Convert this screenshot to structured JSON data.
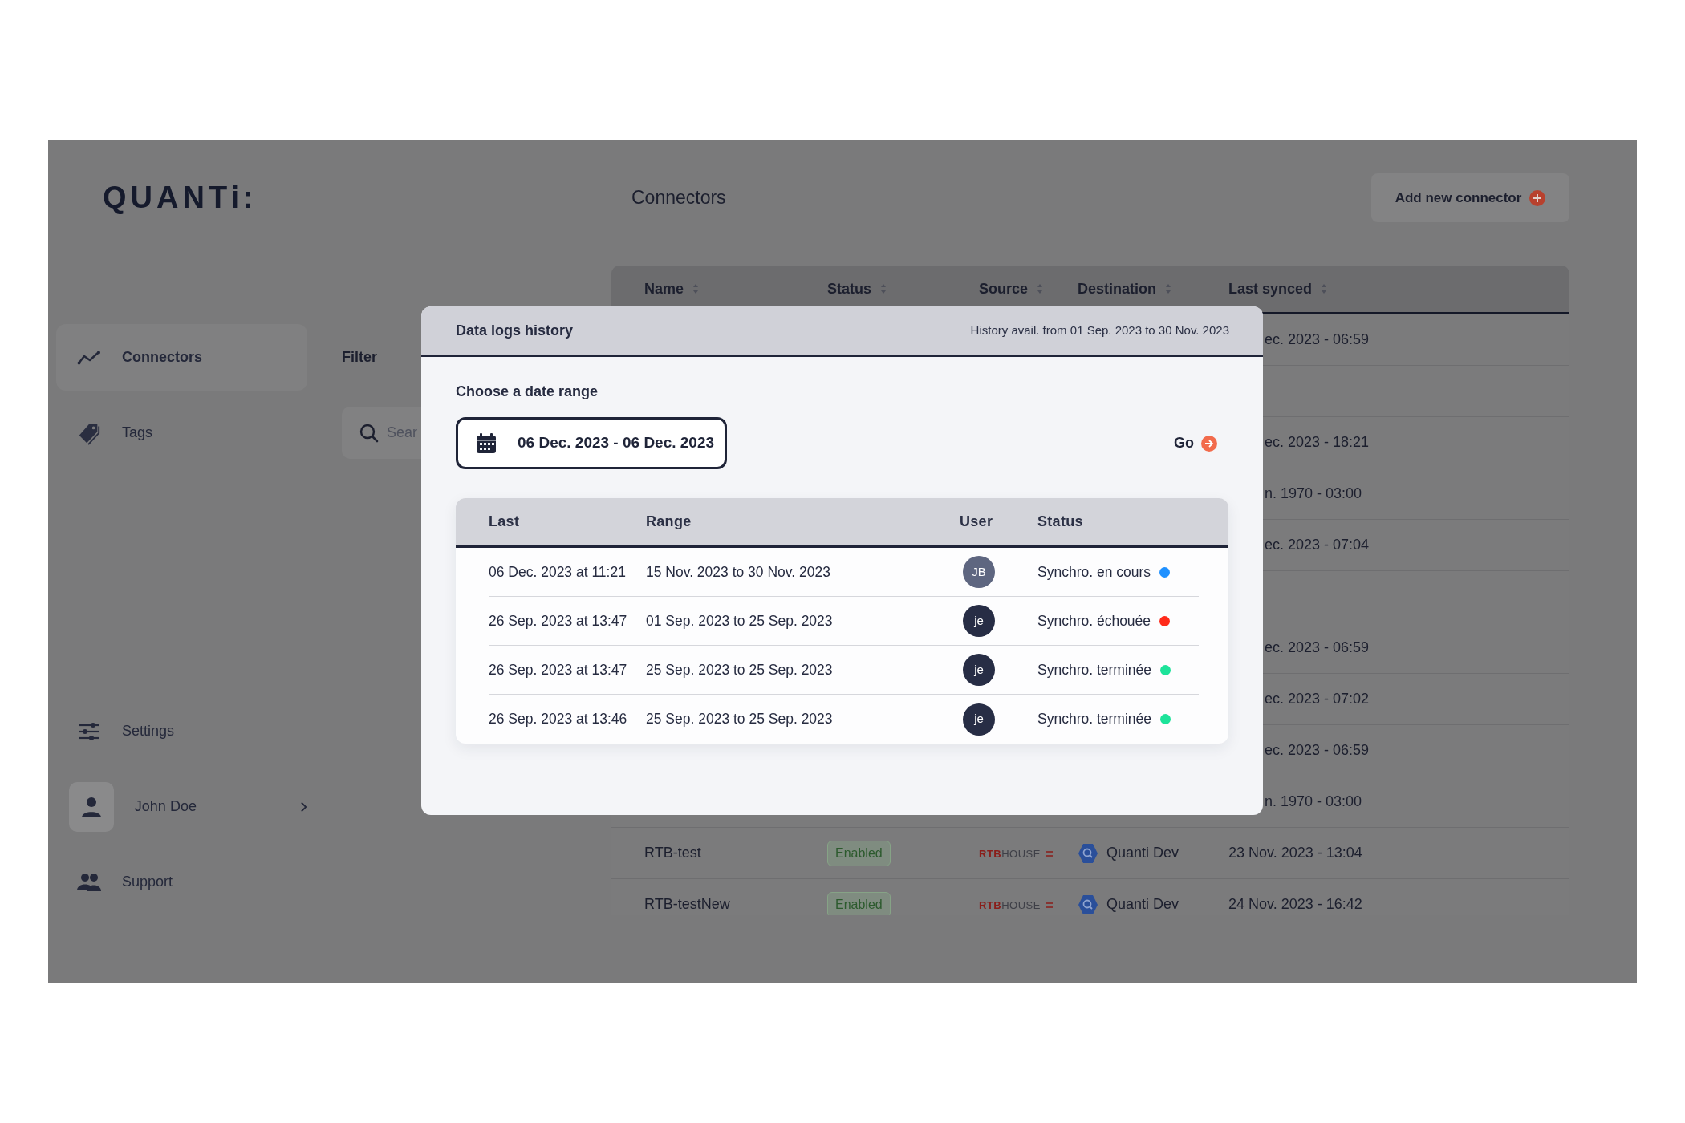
{
  "logo": "QUANTi:",
  "page_title": "Connectors",
  "add_button": "Add new connector",
  "sidebar": {
    "top_items": [
      {
        "label": "Connectors",
        "kind": "nav",
        "selected": true
      },
      {
        "label": "Tags",
        "kind": "nav",
        "selected": false
      }
    ],
    "bottom_items": [
      {
        "label": "Settings",
        "kind": "nav",
        "selected": false
      },
      {
        "label": "John Doe",
        "kind": "user",
        "selected": false
      },
      {
        "label": "Support",
        "kind": "nav",
        "selected": false
      }
    ]
  },
  "filter": {
    "label": "Filter",
    "search_placeholder": "Sear"
  },
  "table": {
    "columns": [
      "Name",
      "Status",
      "Source",
      "Destination",
      "Last synced"
    ],
    "rows": [
      {
        "last_synced": "ec. 2023 - 06:59"
      },
      {},
      {
        "last_synced": "ec. 2023 - 18:21"
      },
      {
        "last_synced": "n. 1970 - 03:00"
      },
      {
        "last_synced": "ec. 2023 - 07:04"
      },
      {},
      {
        "last_synced": "ec. 2023 - 06:59"
      },
      {
        "last_synced": "ec. 2023 - 07:02"
      },
      {
        "last_synced": "ec. 2023 - 06:59"
      },
      {
        "last_synced": "n. 1970 - 03:00"
      },
      {
        "name": "RTB-test",
        "status": "Enabled",
        "source": {
          "mark": "RTB",
          "name": "HOUSE"
        },
        "destination": "Quanti Dev",
        "last_synced": "23 Nov. 2023 - 13:04"
      },
      {
        "name": "RTB-testNew",
        "status": "Enabled",
        "source": {
          "mark": "RTB",
          "name": "HOUSE"
        },
        "destination": "Quanti Dev",
        "last_synced": "24 Nov. 2023 - 16:42"
      }
    ]
  },
  "modal": {
    "title": "Data logs history",
    "availability": "History avail. from 01 Sep. 2023 to 30 Nov. 2023",
    "range_label": "Choose a date range",
    "date_range": "06 Dec. 2023 - 06 Dec. 2023",
    "go_label": "Go",
    "columns": [
      "Last",
      "Range",
      "User",
      "Status"
    ],
    "rows": [
      {
        "last": "06 Dec. 2023 at 11:21",
        "range": "15 Nov. 2023 to 30 Nov. 2023",
        "user": {
          "initials": "JB",
          "color": "#5e6680"
        },
        "status": "Synchro. en cours",
        "color": "#1e90ff"
      },
      {
        "last": "26 Sep. 2023 at 13:47",
        "range": "01 Sep. 2023 to 25 Sep. 2023",
        "user": {
          "initials": "je",
          "color": "#272d45"
        },
        "status": "Synchro. échouée",
        "color": "#ff2a1a"
      },
      {
        "last": "26 Sep. 2023 at 13:47",
        "range": "25 Sep. 2023 to 25 Sep. 2023",
        "user": {
          "initials": "je",
          "color": "#272d45"
        },
        "status": "Synchro. terminée",
        "color": "#1de39a"
      },
      {
        "last": "26 Sep. 2023 at 13:46",
        "range": "25 Sep. 2023 to 25 Sep. 2023",
        "user": {
          "initials": "je",
          "color": "#272d45"
        },
        "status": "Synchro. terminée",
        "color": "#1de39a"
      }
    ]
  }
}
